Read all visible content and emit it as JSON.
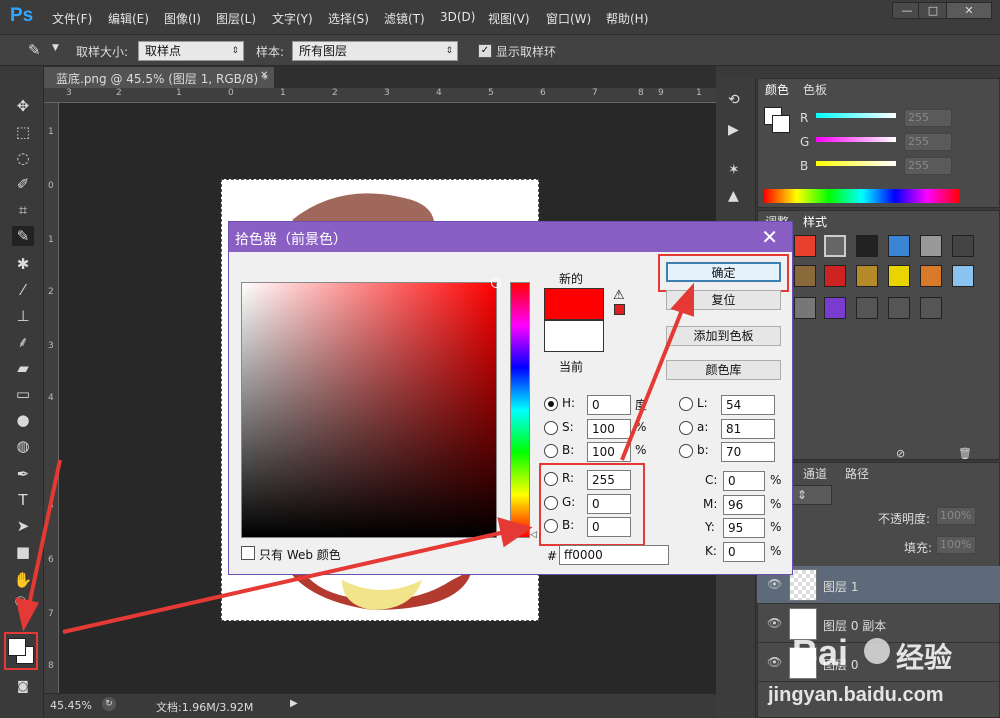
{
  "app": {
    "logo": "Ps",
    "menu": [
      "文件(F)",
      "编辑(E)",
      "图像(I)",
      "图层(L)",
      "文字(Y)",
      "选择(S)",
      "滤镜(T)",
      "3D(D)",
      "视图(V)",
      "窗口(W)",
      "帮助(H)"
    ],
    "window_buttons": [
      "—",
      "□",
      "✕"
    ]
  },
  "options": {
    "sample_size_label": "取样大小:",
    "sample_size_value": "取样点",
    "sample_label": "样本:",
    "sample_value": "所有图层",
    "show_ring_label": "显示取样环"
  },
  "document": {
    "tab_title": "蓝底.png @ 45.5% (图层 1, RGB/8) *",
    "zoom": "45.45%",
    "doc_size": "文档:1.96M/3.92M",
    "ruler_h": [
      "3",
      "2",
      "1",
      "0",
      "1",
      "2",
      "3",
      "4",
      "5",
      "6",
      "7",
      "8",
      "9",
      "1"
    ],
    "ruler_v": [
      "1",
      "0",
      "1",
      "2",
      "3",
      "4",
      "5",
      "6",
      "7",
      "8",
      "9"
    ]
  },
  "color_panel": {
    "tabs": [
      "颜色",
      "色板"
    ],
    "rows": [
      {
        "label": "R",
        "value": "255"
      },
      {
        "label": "G",
        "value": "255"
      },
      {
        "label": "B",
        "value": "255"
      }
    ]
  },
  "styles_panel": {
    "tabs": [
      "调整",
      "样式"
    ]
  },
  "layers_panel": {
    "tabs": [
      "通道",
      "路径"
    ],
    "kind": "类型",
    "opacity_label": "不透明度:",
    "opacity_value": "100%",
    "fill_label": "填充:",
    "fill_value": "100%",
    "layers": [
      {
        "name": "图层 1",
        "selected": true
      },
      {
        "name": "图层 0 副本",
        "selected": false
      },
      {
        "name": "图层 0",
        "selected": false
      }
    ]
  },
  "dialog": {
    "title": "拾色器（前景色）",
    "new_label": "新的",
    "current_label": "当前",
    "ok": "确定",
    "reset": "复位",
    "add_swatch": "添加到色板",
    "color_libs": "颜色库",
    "web_only": "只有 Web 颜色",
    "hsb": [
      {
        "label": "H:",
        "value": "0",
        "unit": "度"
      },
      {
        "label": "S:",
        "value": "100",
        "unit": "%"
      },
      {
        "label": "B:",
        "value": "100",
        "unit": "%"
      }
    ],
    "rgb": [
      {
        "label": "R:",
        "value": "255"
      },
      {
        "label": "G:",
        "value": "0"
      },
      {
        "label": "B:",
        "value": "0"
      }
    ],
    "lab": [
      {
        "label": "L:",
        "value": "54"
      },
      {
        "label": "a:",
        "value": "81"
      },
      {
        "label": "b:",
        "value": "70"
      }
    ],
    "cmyk": [
      {
        "label": "C:",
        "value": "0",
        "unit": "%"
      },
      {
        "label": "M:",
        "value": "96",
        "unit": "%"
      },
      {
        "label": "Y:",
        "value": "95",
        "unit": "%"
      },
      {
        "label": "K:",
        "value": "0",
        "unit": "%"
      }
    ],
    "hex_label": "#",
    "hex_value": "ff0000",
    "new_color": "#ff0000",
    "current_color": "#ffffff"
  },
  "watermark": {
    "brand": "Bai",
    "brand_cn": "经验",
    "url": "jingyan.baidu.com"
  }
}
